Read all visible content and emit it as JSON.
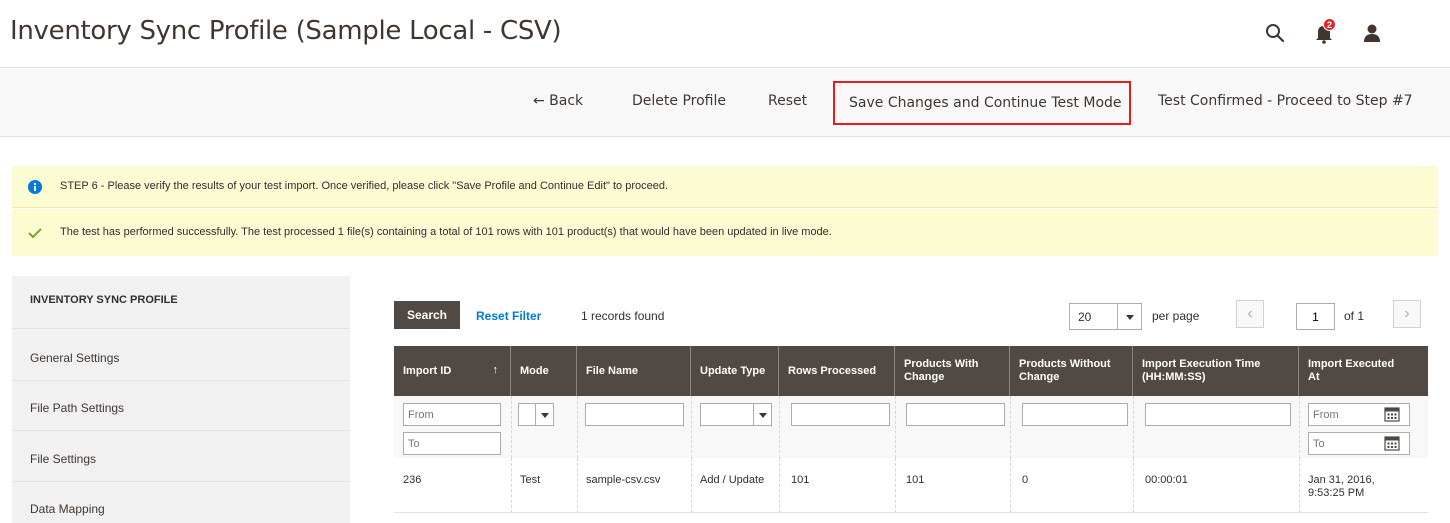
{
  "header": {
    "title": "Inventory Sync Profile (Sample Local - CSV)",
    "notifications_count": "2",
    "icons": [
      "search-icon",
      "bell-icon",
      "user-icon"
    ]
  },
  "toolbar": {
    "back": "← Back",
    "delete": "Delete Profile",
    "reset": "Reset",
    "save": "Save Changes and Continue Test Mode",
    "confirm": "Test Confirmed - Proceed to Step #7"
  },
  "messages": {
    "info": "STEP 6 - Please verify the results of your test import. Once verified, please click \"Save Profile and Continue Edit\" to proceed.",
    "success": "The test has performed successfully. The test processed 1 file(s) containing a total of 101 rows with 101 product(s) that would have been updated in live mode."
  },
  "sidebar": {
    "title": "INVENTORY SYNC PROFILE",
    "items": [
      {
        "label": "General Settings"
      },
      {
        "label": "File Path Settings"
      },
      {
        "label": "File Settings"
      },
      {
        "label": "Data Mapping"
      }
    ]
  },
  "grid": {
    "search_label": "Search",
    "reset_filter_label": "Reset Filter",
    "records_found": "1 records found",
    "per_page_value": "20",
    "per_page_label": "per page",
    "page_value": "1",
    "page_of": "of 1",
    "columns": [
      {
        "line1": "Import ID",
        "line2": ""
      },
      {
        "line1": "Mode",
        "line2": ""
      },
      {
        "line1": "File Name",
        "line2": ""
      },
      {
        "line1": "Update Type",
        "line2": ""
      },
      {
        "line1": "Rows Processed",
        "line2": ""
      },
      {
        "line1": "Products With",
        "line2": "Change"
      },
      {
        "line1": "Products Without",
        "line2": "Change"
      },
      {
        "line1": "Import Execution Time",
        "line2": "(HH:MM:SS)"
      },
      {
        "line1": "Import Executed",
        "line2": "At"
      }
    ],
    "sort_indicator": "↑",
    "filters": {
      "from_placeholder": "From",
      "to_placeholder": "To"
    },
    "rows": [
      {
        "import_id": "236",
        "mode": "Test",
        "file_name": "sample-csv.csv",
        "update_type": "Add / Update",
        "rows_processed": "101",
        "products_with_change": "101",
        "products_without_change": "0",
        "execution_time": "00:00:01",
        "executed_at_date": "Jan 31, 2016,",
        "executed_at_time": "9:53:25 PM"
      }
    ]
  }
}
